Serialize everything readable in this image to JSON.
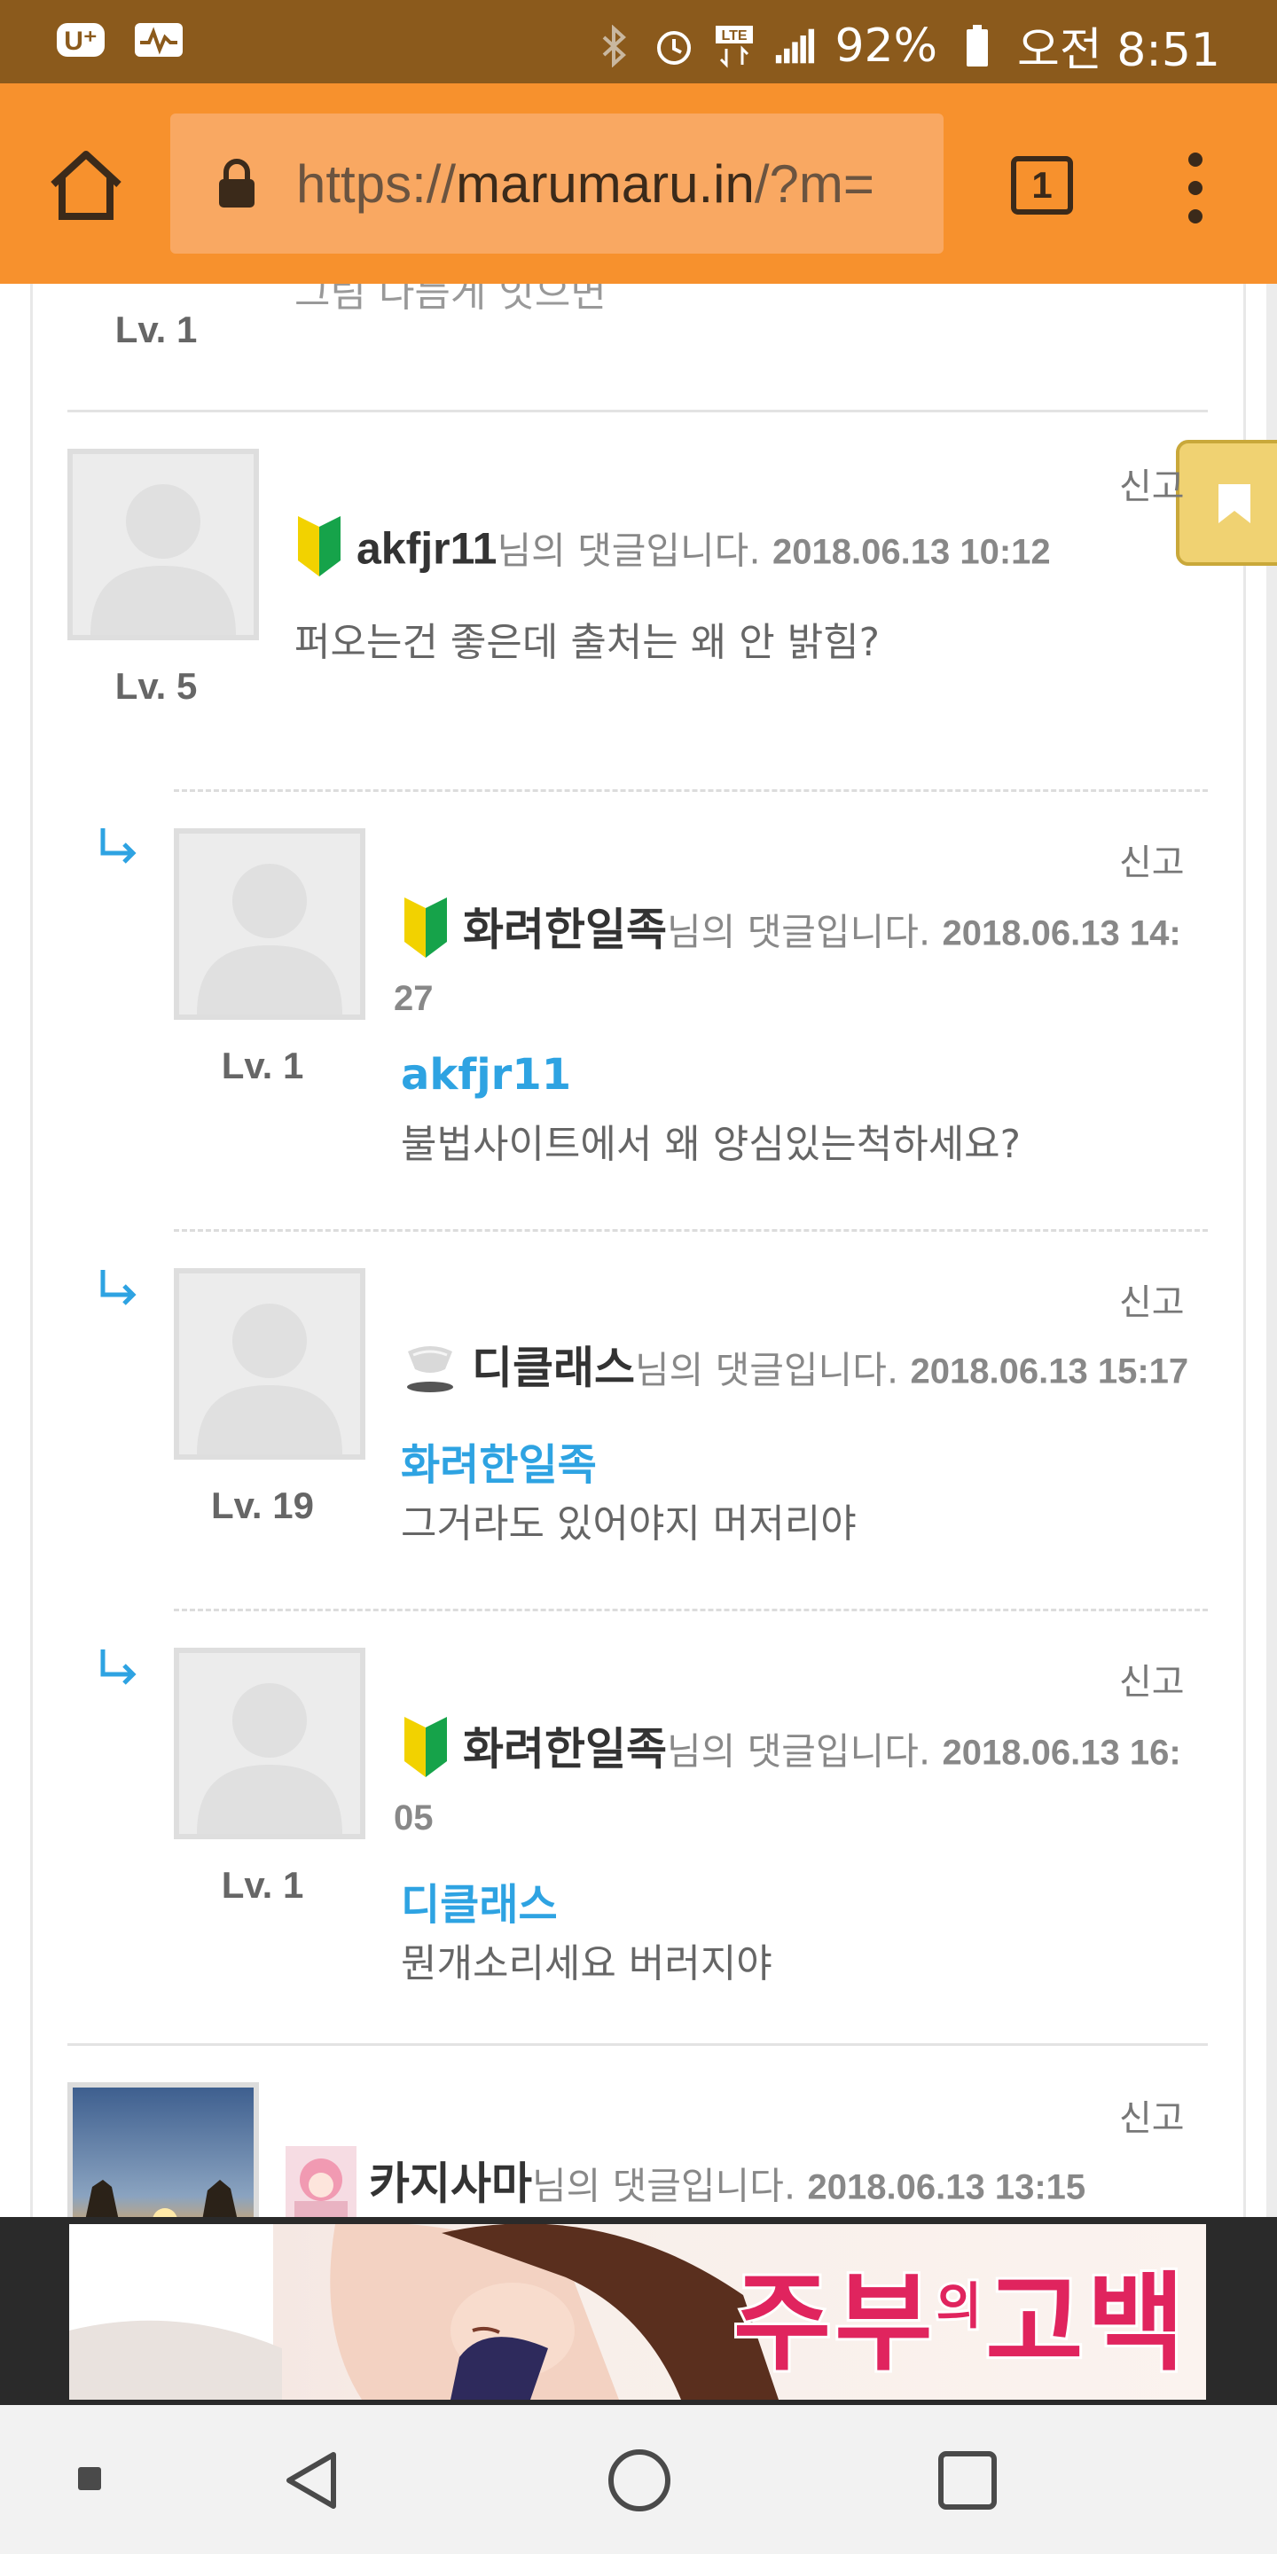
{
  "status_bar": {
    "battery": "92%",
    "time": "오전 8:51",
    "network": "LTE",
    "left_icons": [
      "app-notification-icon",
      "activity-icon"
    ],
    "right_icons": [
      "bluetooth-icon",
      "alarm-icon",
      "lte-icon",
      "signal-icon",
      "battery-icon"
    ]
  },
  "browser": {
    "url_scheme": "https://",
    "url_host": "marumaru.in",
    "url_rest": "/?m=",
    "tab_count": "1"
  },
  "comments": {
    "prev": {
      "level": "Lv. 1",
      "partial_text": "그림 다듬게 잇으면"
    },
    "items": [
      {
        "username": "akfjr11",
        "suffix": "님의 댓글입니다.",
        "date": "2018.06.13 10:12",
        "level": "Lv. 5",
        "text": "퍼오는건 좋은데 출처는 왜 안 밝힘?",
        "report": "신고"
      },
      {
        "username": "화려한일족",
        "suffix": "님의 댓글입니다.",
        "date_part1": "2018.06.13 14:",
        "date_part2": "27",
        "level": "Lv. 1",
        "mention": "akfjr11",
        "text": "불법사이트에서 왜 양심있는척하세요?",
        "report": "신고"
      },
      {
        "username": "디클래스",
        "suffix": "님의 댓글입니다.",
        "date": "2018.06.13 15:17",
        "level": "Lv. 19",
        "mention": "화려한일족",
        "text": "그거라도 있어야지 머저리야",
        "report": "신고"
      },
      {
        "username": "화려한일족",
        "suffix": "님의 댓글입니다.",
        "date_part1": "2018.06.13 16:",
        "date_part2": "05",
        "level": "Lv. 1",
        "mention": "디클래스",
        "text": "뭔개소리세요 버러지야",
        "report": "신고"
      },
      {
        "username": "카지사마",
        "suffix": "님의 댓글입니다.",
        "date": "2018.06.13 13:15",
        "report": "신고"
      }
    ]
  },
  "ad": {
    "title_a": "주부",
    "title_small": "의",
    "title_b": "고백"
  },
  "colors": {
    "status_bar": "#8b5a1c",
    "browser_bar": "#f7912d",
    "mention": "#2ea3e2",
    "bookmark": "#f0d272"
  }
}
